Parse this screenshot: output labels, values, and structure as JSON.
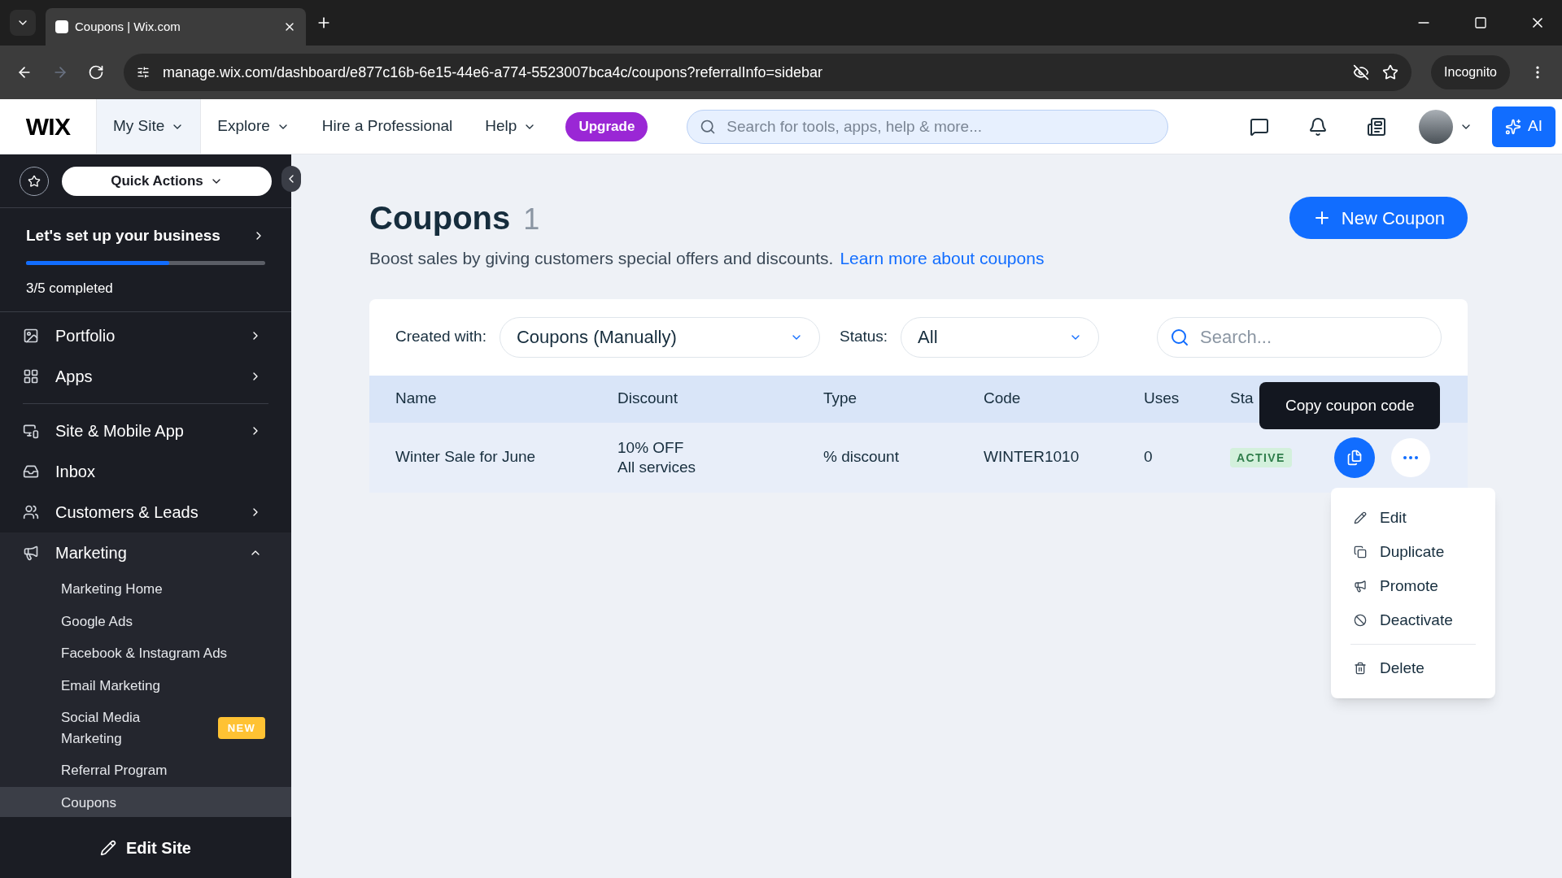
{
  "browser": {
    "tab_title": "Coupons | Wix.com",
    "url": "manage.wix.com/dashboard/e877c16b-6e15-44e6-a774-5523007bca4c/coupons?referralInfo=sidebar",
    "profile": "Incognito"
  },
  "header": {
    "logo": "WIX",
    "nav": [
      {
        "label": "My Site",
        "dropdown": true,
        "selected": true
      },
      {
        "label": "Explore",
        "dropdown": true,
        "selected": false
      },
      {
        "label": "Hire a Professional",
        "dropdown": false,
        "selected": false
      },
      {
        "label": "Help",
        "dropdown": true,
        "selected": false
      }
    ],
    "upgrade": "Upgrade",
    "search": {
      "placeholder": "Search for tools, apps, help & more..."
    },
    "ai": "AI"
  },
  "sidebar": {
    "quick_actions": "Quick Actions",
    "setup": {
      "title": "Let's set up your business",
      "level": 0.6,
      "progress": "3/5 completed"
    },
    "items": [
      {
        "label": "Portfolio",
        "chevron": true,
        "expanded": false,
        "divider_after": false
      },
      {
        "label": "Apps",
        "chevron": true,
        "expanded": false,
        "divider_after": true
      },
      {
        "label": "Site & Mobile App",
        "chevron": true,
        "expanded": false,
        "divider_after": false
      },
      {
        "label": "Inbox",
        "chevron": false,
        "divider_after": false
      },
      {
        "label": "Customers & Leads",
        "chevron": true,
        "expanded": false,
        "divider_after": false
      },
      {
        "label": "Marketing",
        "chevron": true,
        "expanded": true,
        "divider_after": false,
        "children": [
          {
            "label": "Marketing Home",
            "selected": false
          },
          {
            "label": "Google Ads",
            "selected": false
          },
          {
            "label": "Facebook & Instagram Ads",
            "selected": false
          },
          {
            "label": "Email Marketing",
            "selected": false
          },
          {
            "label": "Social Media Marketing",
            "badge": "NEW",
            "selected": false
          },
          {
            "label": "Referral Program",
            "selected": false
          },
          {
            "label": "Coupons",
            "selected": true
          }
        ]
      }
    ],
    "edit_site": "Edit Site"
  },
  "page": {
    "title": "Coupons",
    "count": "1",
    "subtitle": "Boost sales by giving customers special offers and discounts.",
    "link": "Learn more about coupons",
    "new_button": "New Coupon"
  },
  "filters": {
    "created_label": "Created with:",
    "created_value": "Coupons (Manually)",
    "status_label": "Status:",
    "status_value": "All",
    "search": {
      "placeholder": "Search..."
    }
  },
  "table": {
    "columns": [
      "Name",
      "Discount",
      "Type",
      "Code",
      "Uses",
      "Sta"
    ],
    "rows": [
      {
        "name": "Winter Sale for June",
        "discount": [
          "10% OFF",
          "All services"
        ],
        "type": "% discount",
        "code": "WINTER1010",
        "uses": "0",
        "status": "ACTIVE"
      }
    ]
  },
  "tooltip": "Copy coupon code",
  "menu": [
    {
      "label": "Edit",
      "divider_before": false
    },
    {
      "label": "Duplicate",
      "divider_before": false
    },
    {
      "label": "Promote",
      "divider_before": false
    },
    {
      "label": "Deactivate",
      "divider_before": false
    },
    {
      "label": "Delete",
      "divider_before": true
    }
  ]
}
